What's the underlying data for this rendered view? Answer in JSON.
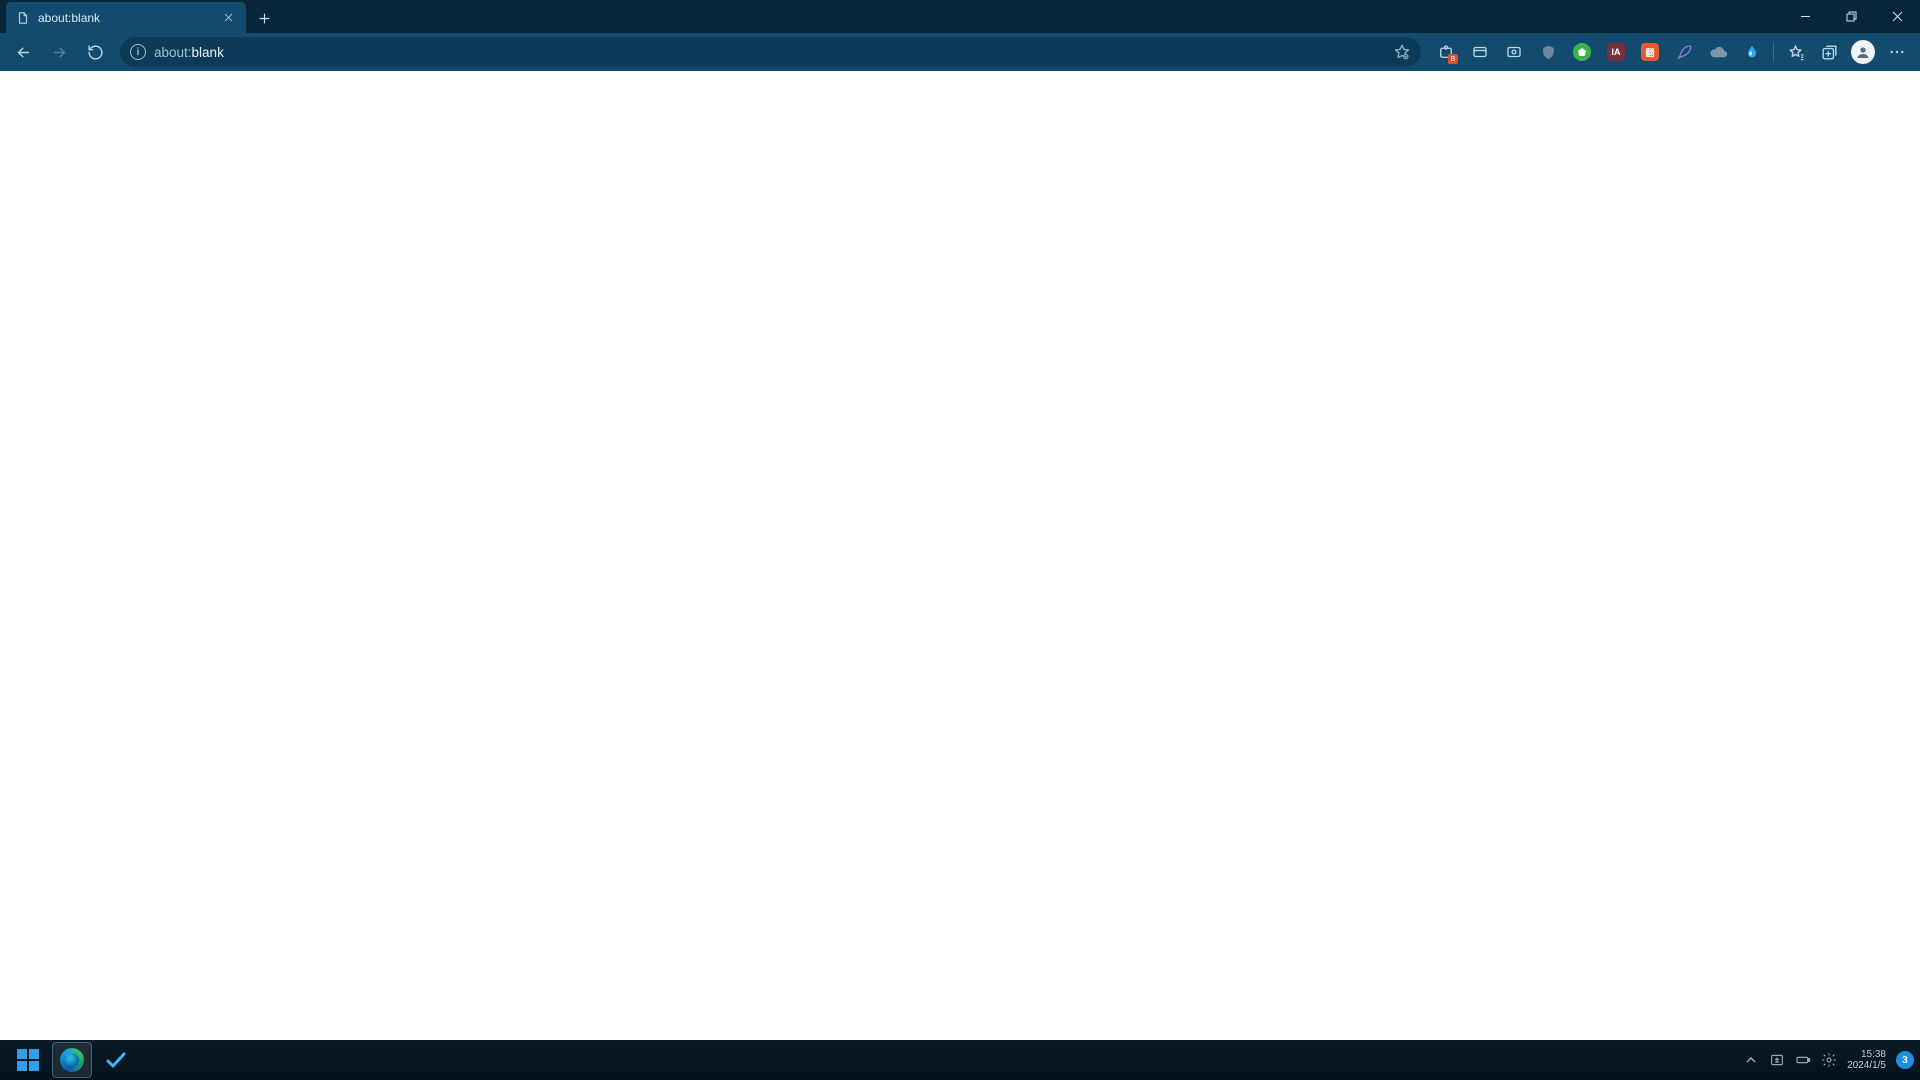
{
  "tab": {
    "title": "about:blank"
  },
  "address": {
    "prefix": "about:",
    "suffix": "blank"
  },
  "info_glyph": "i",
  "extensions": {
    "badge_b": "B",
    "ia_label": "IA",
    "mt_label": "翻"
  },
  "tray": {
    "time": "15:38",
    "date": "2024/1/5",
    "notif_count": "3"
  }
}
